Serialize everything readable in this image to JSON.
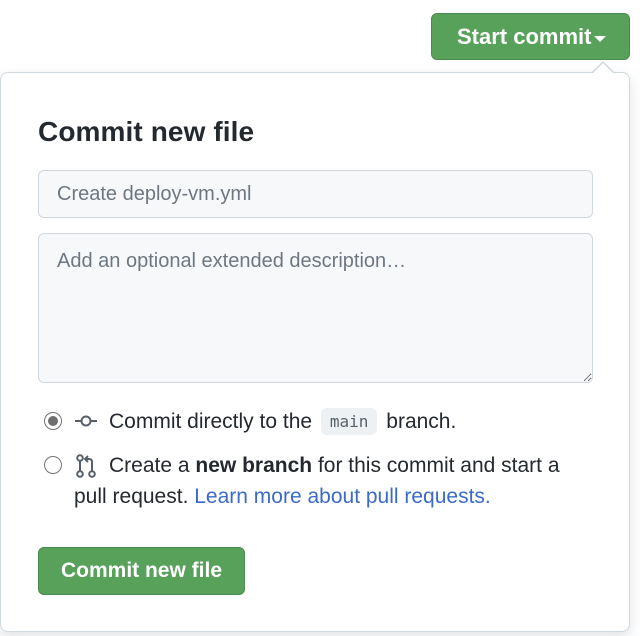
{
  "header": {
    "start_commit_label": "Start commit"
  },
  "popover": {
    "title": "Commit new file",
    "summary": {
      "placeholder": "Create deploy-vm.yml",
      "value": ""
    },
    "description": {
      "placeholder": "Add an optional extended description…",
      "value": ""
    },
    "options": [
      {
        "selected": true,
        "prefix": "Commit directly to the",
        "branch": "main",
        "suffix": "branch."
      },
      {
        "selected": false,
        "line1_prefix": "Create a",
        "line1_bold": "new branch",
        "line1_suffix": "for this commit and start a",
        "line2_text": "pull request.",
        "line2_link": "Learn more about pull requests."
      }
    ],
    "submit_label": "Commit new file"
  },
  "colors": {
    "primary_button": "#57a15a",
    "link": "#3b6bc7",
    "input_background": "#f6f8fa",
    "border": "#d0d7de"
  },
  "icons": {
    "option_direct": "git-commit-icon",
    "option_branch": "git-pull-request-icon",
    "dropdown": "caret-down-icon"
  }
}
